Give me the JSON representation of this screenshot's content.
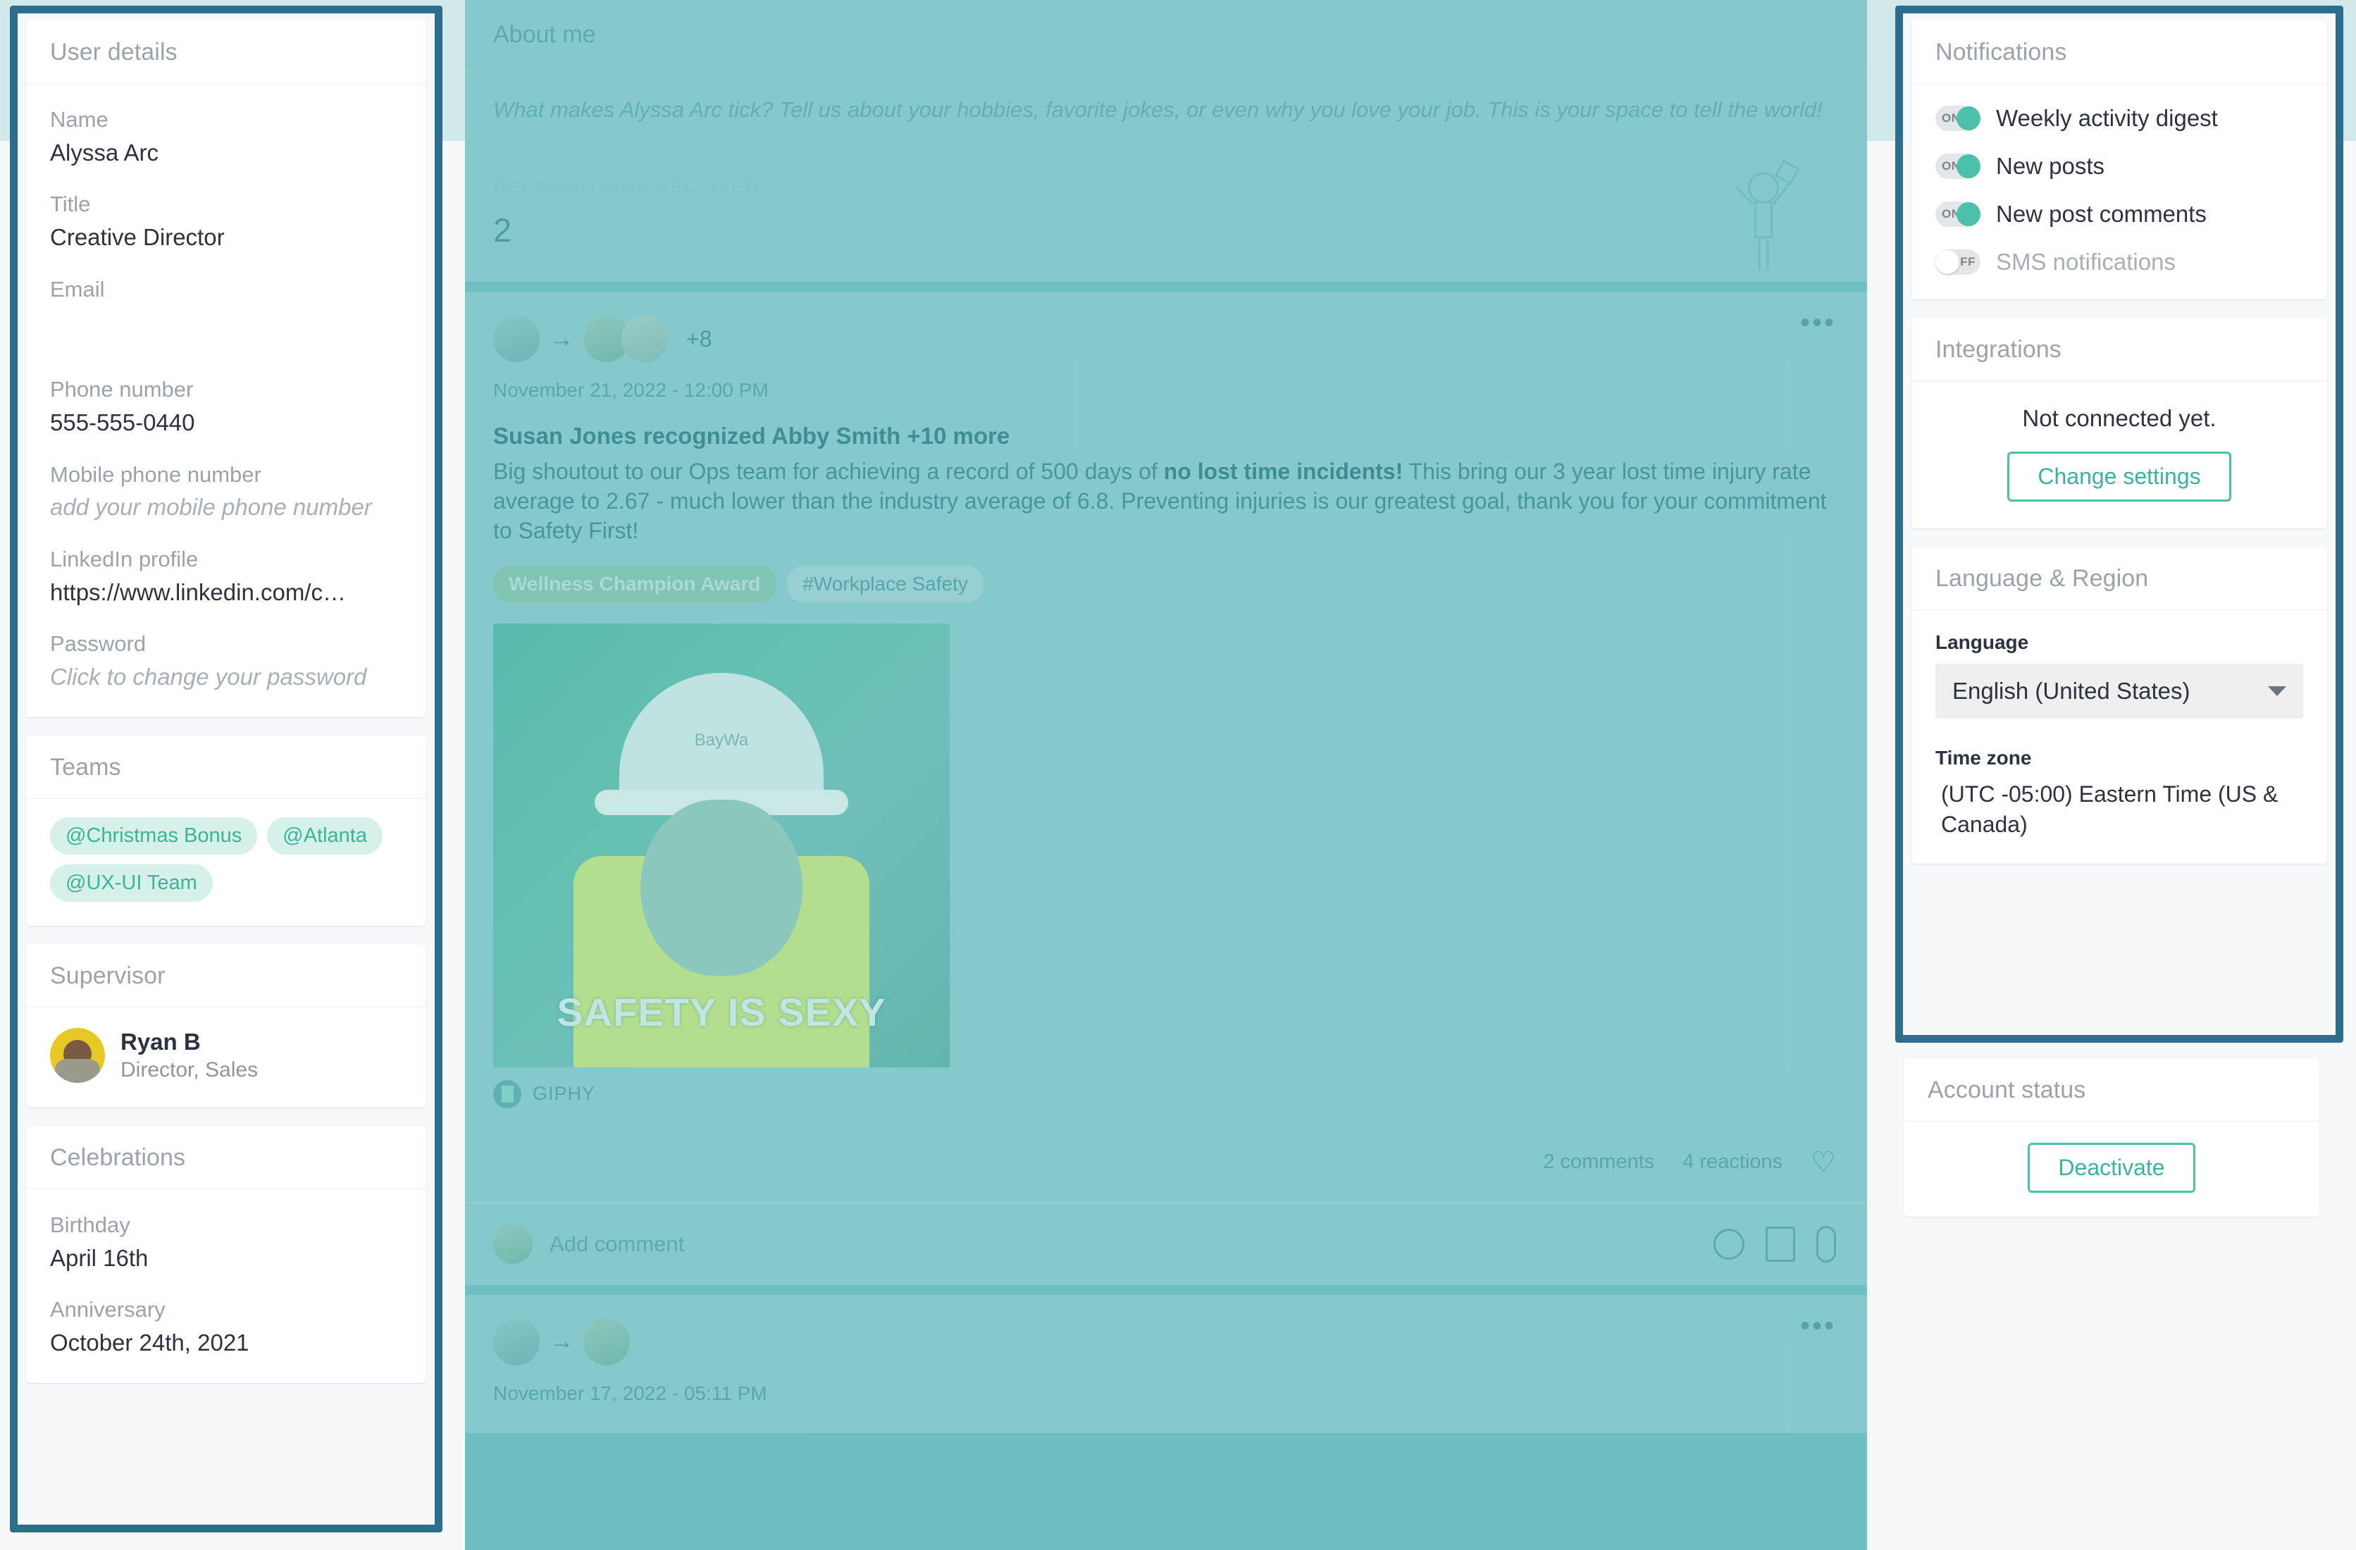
{
  "left_panel": {
    "user_details": {
      "title": "User details",
      "fields": [
        {
          "label": "Name",
          "value": "Alyssa Arc",
          "placeholder": false
        },
        {
          "label": "Title",
          "value": "Creative Director",
          "placeholder": false
        },
        {
          "label": "Email",
          "value": "",
          "placeholder": false
        },
        {
          "label": "Phone number",
          "value": "555-555-0440",
          "placeholder": false
        },
        {
          "label": "Mobile phone number",
          "value": "add your mobile phone number",
          "placeholder": true
        },
        {
          "label": "LinkedIn profile",
          "value": "https://www.linkedin.com/c…",
          "placeholder": false
        },
        {
          "label": "Password",
          "value": "Click to change your password",
          "placeholder": true
        }
      ]
    },
    "teams": {
      "title": "Teams",
      "chips": [
        "@Christmas Bonus",
        "@Atlanta",
        "@UX-UI Team"
      ]
    },
    "supervisor": {
      "title": "Supervisor",
      "name": "Ryan B",
      "role": "Director, Sales"
    },
    "celebrations": {
      "title": "Celebrations",
      "fields": [
        {
          "label": "Birthday",
          "value": "April 16th"
        },
        {
          "label": "Anniversary",
          "value": "October 24th, 2021"
        }
      ]
    }
  },
  "main": {
    "about": {
      "title": "About me",
      "placeholder": "What makes Alyssa Arc tick? Tell us about your hobbies, favorite jokes, or even why you love your job. This is your space to tell the world!"
    },
    "recognitions": {
      "label": "RECOGNITIONS RECEIVED",
      "count": "2"
    },
    "post": {
      "extra_people": "+8",
      "timestamp": "November 21, 2022 - 12:00 PM",
      "headline": "Susan Jones recognized Abby Smith +10 more",
      "body_part1": "Big shoutout to our Ops team for achieving a record of 500 days of ",
      "body_bold": "no lost time incidents!",
      "body_part2": " This bring our 3 year lost time injury rate average to 2.67 - much lower than the industry average of 6.8. Preventing injuries is our greatest goal, thank you for your commitment to Safety First!",
      "tags": [
        {
          "text": "Wellness Champion Award",
          "kind": "award"
        },
        {
          "text": "#Workplace Safety",
          "kind": "hash"
        }
      ],
      "gif_caption": "SAFETY IS SEXY",
      "gif_helmet_text": "BayWa",
      "gif_source": "GIPHY",
      "comments_count": "2 comments",
      "reactions_count": "4 reactions",
      "menu_icon": "more-options-icon",
      "heart_icon": "heart-icon"
    },
    "comment_box": {
      "placeholder": "Add comment",
      "icons": [
        "emoji-icon",
        "image-icon",
        "attachment-icon"
      ]
    },
    "post2": {
      "timestamp": "November 17, 2022 - 05:11 PM",
      "menu_icon": "more-options-icon"
    }
  },
  "right_panel": {
    "notifications": {
      "title": "Notifications",
      "items": [
        {
          "label": "Weekly activity digest",
          "state": "ON",
          "on": true
        },
        {
          "label": "New posts",
          "state": "ON",
          "on": true
        },
        {
          "label": "New post comments",
          "state": "ON",
          "on": true
        },
        {
          "label": "SMS notifications",
          "state": "OFF",
          "on": false
        }
      ]
    },
    "integrations": {
      "title": "Integrations",
      "message": "Not connected yet.",
      "button": "Change settings"
    },
    "language_region": {
      "title": "Language & Region",
      "language_label": "Language",
      "language_value": "English (United States)",
      "timezone_label": "Time zone",
      "timezone_value": "(UTC -05:00)  Eastern Time (US & Canada)"
    },
    "account_status": {
      "title": "Account status",
      "button": "Deactivate"
    }
  },
  "colors": {
    "highlight_border": "#2c6e8e",
    "accent_teal": "#4cc0ab",
    "overlay_teal": "#6dbfc2",
    "chip_bg": "#d6f0ea",
    "chip_text": "#39b59a"
  }
}
